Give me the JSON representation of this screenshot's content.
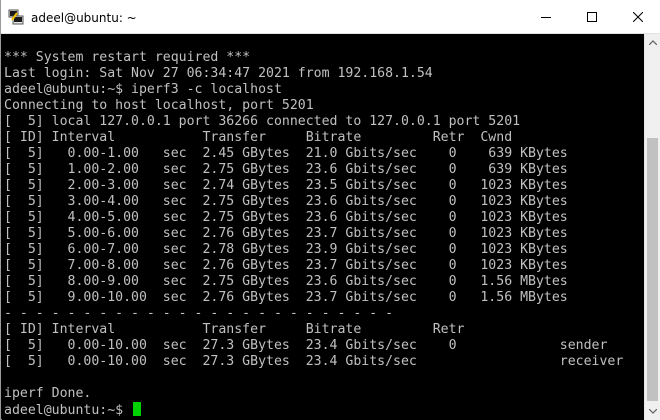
{
  "window": {
    "title": "adeel@ubuntu: ~",
    "icon": "putty-terminal-icon",
    "controls": [
      "minimize-icon",
      "maximize-icon",
      "close-icon"
    ]
  },
  "terminal": {
    "foreground": "#c0c0c0",
    "background": "#000000",
    "cursor_color": "#00d100",
    "lines": [
      "",
      "*** System restart required ***",
      "Last login: Sat Nov 27 06:34:47 2021 from 192.168.1.54",
      "adeel@ubuntu:~$ iperf3 -c localhost",
      "Connecting to host localhost, port 5201",
      "[  5] local 127.0.0.1 port 36266 connected to 127.0.0.1 port 5201",
      "[ ID] Interval           Transfer     Bitrate         Retr  Cwnd",
      "[  5]   0.00-1.00   sec  2.45 GBytes  21.0 Gbits/sec    0    639 KBytes",
      "[  5]   1.00-2.00   sec  2.75 GBytes  23.6 Gbits/sec    0    639 KBytes",
      "[  5]   2.00-3.00   sec  2.74 GBytes  23.5 Gbits/sec    0   1023 KBytes",
      "[  5]   3.00-4.00   sec  2.75 GBytes  23.6 Gbits/sec    0   1023 KBytes",
      "[  5]   4.00-5.00   sec  2.75 GBytes  23.6 Gbits/sec    0   1023 KBytes",
      "[  5]   5.00-6.00   sec  2.76 GBytes  23.7 Gbits/sec    0   1023 KBytes",
      "[  5]   6.00-7.00   sec  2.78 GBytes  23.9 Gbits/sec    0   1023 KBytes",
      "[  5]   7.00-8.00   sec  2.76 GBytes  23.7 Gbits/sec    0   1023 KBytes",
      "[  5]   8.00-9.00   sec  2.75 GBytes  23.6 Gbits/sec    0   1.56 MBytes",
      "[  5]   9.00-10.00  sec  2.76 GBytes  23.7 Gbits/sec    0   1.56 MBytes",
      "- - - - - - - - - - - - - - - - - - - - - - - - -",
      "[ ID] Interval           Transfer     Bitrate         Retr",
      "[  5]   0.00-10.00  sec  27.3 GBytes  23.4 Gbits/sec    0             sender",
      "[  5]   0.00-10.00  sec  27.3 GBytes  23.4 Gbits/sec                  receiver",
      "",
      "iperf Done."
    ],
    "prompt": "adeel@ubuntu:~$ "
  }
}
